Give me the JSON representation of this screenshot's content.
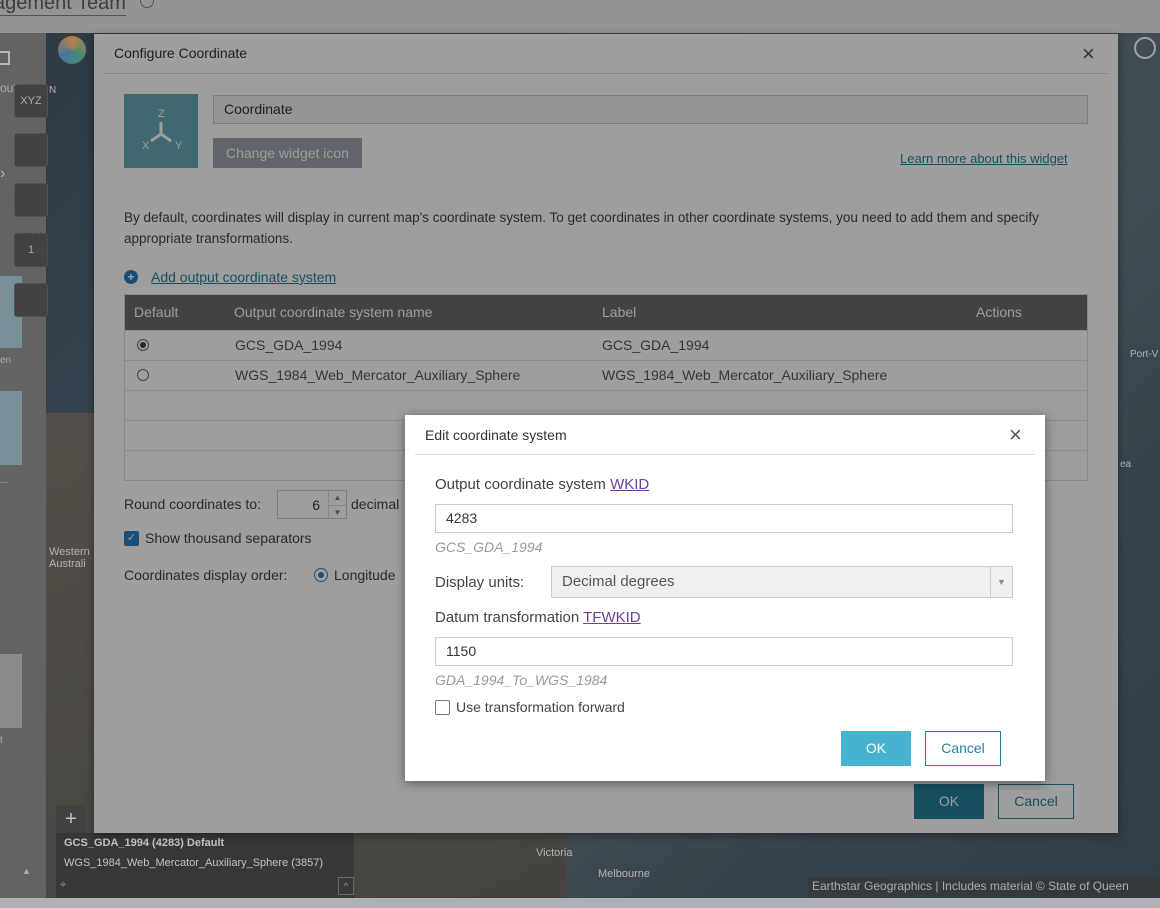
{
  "background": {
    "page_title": "agement Team",
    "left_panel": {
      "item1": "oute",
      "item2": "en",
      "item3": "...",
      "item4": "t"
    },
    "map_labels": {
      "western_australia": "Western\nAustrali",
      "victoria": "Victoria",
      "melbourne": "Melbourne",
      "port": "Port-V",
      "sea": "ea",
      "n_label": "N"
    },
    "map_tools": [
      "XYZ",
      "",
      "",
      "1",
      ""
    ],
    "coordinate_bar": {
      "line1": "GCS_GDA_1994 (4283) Default",
      "line2": "WGS_1984_Web_Mercator_Auxiliary_Sphere  (3857)"
    },
    "attribution": "Earthstar Geographics | Includes material © State of Queen"
  },
  "config_dialog": {
    "title": "Configure Coordinate",
    "widget_name": "Coordinate",
    "change_icon_label": "Change widget icon",
    "learn_more": "Learn more about this widget",
    "description": "By default, coordinates will display in current map's coordinate system. To get coordinates in other coordinate systems, you need to add them and specify appropriate transformations.",
    "add_output_label": "Add output coordinate system",
    "table": {
      "headers": [
        "Default",
        "Output coordinate system name",
        "Label",
        "Actions"
      ],
      "rows": [
        {
          "name": "GCS_GDA_1994",
          "label": "GCS_GDA_1994",
          "default": true
        },
        {
          "name": "WGS_1984_Web_Mercator_Auxiliary_Sphere",
          "label": "WGS_1984_Web_Mercator_Auxiliary_Sphere",
          "default": false
        }
      ]
    },
    "round_label": "Round coordinates to:",
    "round_value": "6",
    "decimal_label": "decimal",
    "show_thousand": "Show thousand separators",
    "display_order_label": "Coordinates display order:",
    "display_order_value": "Longitude",
    "ok": "OK",
    "cancel": "Cancel"
  },
  "edit_dialog": {
    "title": "Edit coordinate system",
    "output_label": "Output coordinate system",
    "wkid_link": "WKID",
    "wkid_value": "4283",
    "wkid_hint": "GCS_GDA_1994",
    "display_units_label": "Display units:",
    "display_units_value": "Decimal degrees",
    "datum_label": "Datum transformation",
    "tfwkid_link": "TFWKID",
    "tfwkid_value": "1150",
    "tfwkid_hint": "GDA_1994_To_WGS_1984",
    "use_forward": "Use transformation forward",
    "ok": "OK",
    "cancel": "Cancel"
  }
}
